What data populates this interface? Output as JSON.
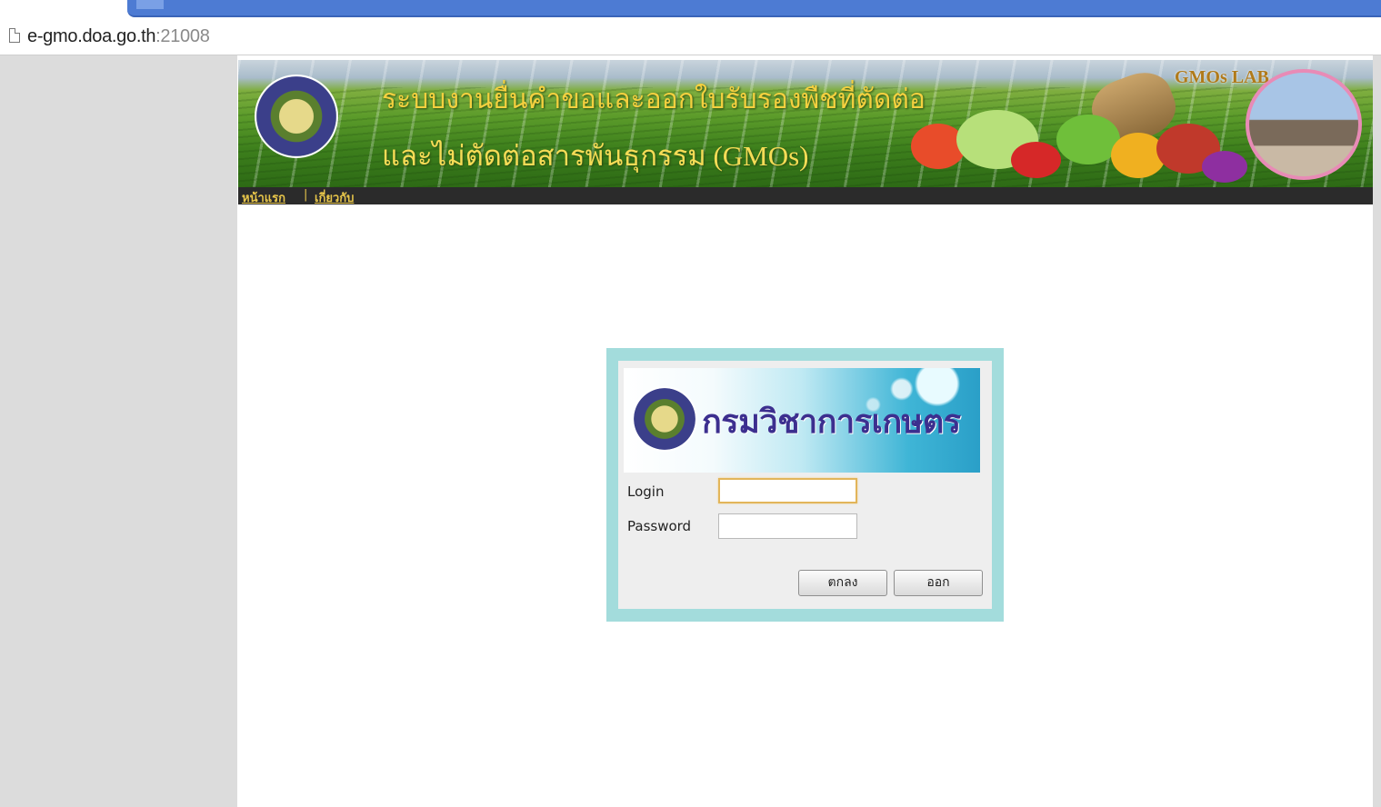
{
  "browser": {
    "url_host": "e-gmo.doa.go.th",
    "url_port": ":21008"
  },
  "header": {
    "title_line1": "ระบบงานยื่นคำขอและออกใบรับรองพืชที่ตัดต่อ",
    "title_line2": "และไม่ตัดต่อสารพันธุกรรม (GMOs)",
    "lab_label": "GMOs LAB",
    "seal_icon": "doa-seal-icon"
  },
  "nav": {
    "home": "หน้าแรก",
    "separator": "|",
    "about": "เกี่ยวกับ",
    "link_color": "#e8c64a"
  },
  "login": {
    "department": "กรมวิชาการเกษตร",
    "login_label": "Login",
    "password_label": "Password",
    "login_value": "",
    "password_value": "",
    "ok_button": "ตกลง",
    "exit_button": "ออก",
    "frame_color": "#a3dcdc"
  }
}
